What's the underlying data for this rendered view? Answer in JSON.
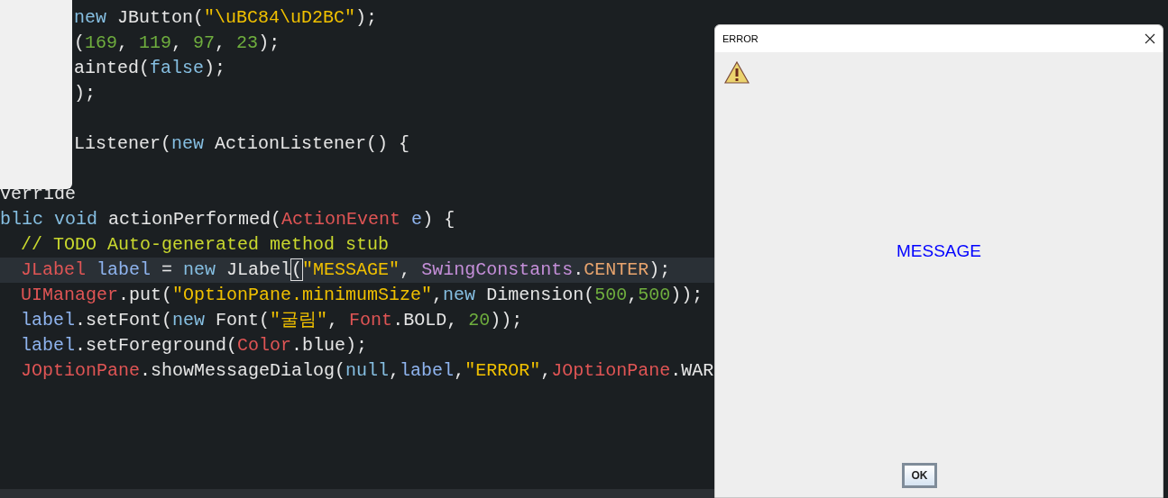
{
  "editor": {
    "covered_lines": [
      {
        "kind": "code",
        "segments": [
          {
            "kind": "keyword",
            "text": "new"
          },
          {
            "kind": "plain",
            "text": " JButton("
          },
          {
            "kind": "string",
            "text": "\"\\uBC84\\uD2BC\""
          },
          {
            "kind": "plain",
            "text": ");"
          }
        ]
      },
      {
        "kind": "code",
        "segments": [
          {
            "kind": "plain",
            "text": "("
          },
          {
            "kind": "number",
            "text": "169"
          },
          {
            "kind": "plain",
            "text": ", "
          },
          {
            "kind": "number",
            "text": "119"
          },
          {
            "kind": "plain",
            "text": ", "
          },
          {
            "kind": "number",
            "text": "97"
          },
          {
            "kind": "plain",
            "text": ", "
          },
          {
            "kind": "number",
            "text": "23"
          },
          {
            "kind": "plain",
            "text": ");"
          }
        ]
      },
      {
        "kind": "code",
        "segments": [
          {
            "kind": "plain",
            "text": "ainted("
          },
          {
            "kind": "keyword",
            "text": "false"
          },
          {
            "kind": "plain",
            "text": ");"
          }
        ]
      },
      {
        "kind": "code",
        "segments": [
          {
            "kind": "plain",
            "text": ");"
          }
        ]
      },
      {
        "kind": "blank"
      },
      {
        "kind": "code",
        "segments": [
          {
            "kind": "plain",
            "text": "Listener("
          },
          {
            "kind": "keyword",
            "text": "new"
          },
          {
            "kind": "plain",
            "text": " ActionListener() {"
          }
        ]
      },
      {
        "kind": "blank"
      }
    ],
    "lines": [
      {
        "indented": false,
        "highlighted": false,
        "segments": [
          {
            "kind": "plain",
            "text": "verride"
          }
        ]
      },
      {
        "indented": false,
        "highlighted": false,
        "segments": [
          {
            "kind": "keyword",
            "text": "blic void"
          },
          {
            "kind": "plain",
            "text": " actionPerformed("
          },
          {
            "kind": "type",
            "text": "ActionEvent"
          },
          {
            "kind": "variable",
            "text": " e"
          },
          {
            "kind": "plain",
            "text": ") {"
          }
        ]
      },
      {
        "indented": true,
        "highlighted": false,
        "segments": [
          {
            "kind": "comment",
            "text": "// TODO Auto-generated method stub"
          }
        ]
      },
      {
        "indented": true,
        "highlighted": true,
        "segments": [
          {
            "kind": "type",
            "text": "JLabel"
          },
          {
            "kind": "variable",
            "text": " label"
          },
          {
            "kind": "plain",
            "text": " = "
          },
          {
            "kind": "keyword",
            "text": "new"
          },
          {
            "kind": "plain",
            "text": " JLabel"
          },
          {
            "kind": "bracket_match",
            "text": "("
          },
          {
            "kind": "string",
            "text": "\"MESSAGE\""
          },
          {
            "kind": "plain",
            "text": ", "
          },
          {
            "kind": "class",
            "text": "SwingConstants"
          },
          {
            "kind": "plain",
            "text": "."
          },
          {
            "kind": "constant",
            "text": "CENTER"
          },
          {
            "kind": "plain",
            "text": ");"
          }
        ]
      },
      {
        "indented": true,
        "highlighted": false,
        "segments": [
          {
            "kind": "type",
            "text": "UIManager"
          },
          {
            "kind": "plain",
            "text": ".put("
          },
          {
            "kind": "string",
            "text": "\"OptionPane.minimumSize\""
          },
          {
            "kind": "plain",
            "text": ","
          },
          {
            "kind": "keyword",
            "text": "new"
          },
          {
            "kind": "plain",
            "text": " Dimension("
          },
          {
            "kind": "number",
            "text": "500"
          },
          {
            "kind": "plain",
            "text": ","
          },
          {
            "kind": "number",
            "text": "500"
          },
          {
            "kind": "plain",
            "text": "));"
          }
        ]
      },
      {
        "indented": true,
        "highlighted": false,
        "segments": [
          {
            "kind": "variable",
            "text": "label"
          },
          {
            "kind": "plain",
            "text": ".setFont("
          },
          {
            "kind": "keyword",
            "text": "new"
          },
          {
            "kind": "plain",
            "text": " Font("
          },
          {
            "kind": "string",
            "text": "\"굴림\""
          },
          {
            "kind": "plain",
            "text": ", "
          },
          {
            "kind": "type",
            "text": "Font"
          },
          {
            "kind": "plain",
            "text": ".BOLD, "
          },
          {
            "kind": "number",
            "text": "20"
          },
          {
            "kind": "plain",
            "text": "));"
          }
        ]
      },
      {
        "indented": true,
        "highlighted": false,
        "segments": [
          {
            "kind": "variable",
            "text": "label"
          },
          {
            "kind": "plain",
            "text": ".setForeground("
          },
          {
            "kind": "type",
            "text": "Color"
          },
          {
            "kind": "plain",
            "text": ".blue);"
          }
        ]
      },
      {
        "indented": true,
        "highlighted": false,
        "segments": [
          {
            "kind": "type",
            "text": "JOptionPane"
          },
          {
            "kind": "plain",
            "text": ".showMessageDialog("
          },
          {
            "kind": "keyword",
            "text": "null"
          },
          {
            "kind": "plain",
            "text": ","
          },
          {
            "kind": "variable",
            "text": "label"
          },
          {
            "kind": "plain",
            "text": ","
          },
          {
            "kind": "string",
            "text": "\"ERROR\""
          },
          {
            "kind": "plain",
            "text": ","
          },
          {
            "kind": "type",
            "text": "JOptionPane"
          },
          {
            "kind": "plain",
            "text": ".WAR"
          }
        ]
      }
    ]
  },
  "dialog": {
    "title": "ERROR",
    "message": "MESSAGE",
    "button": "OK"
  }
}
